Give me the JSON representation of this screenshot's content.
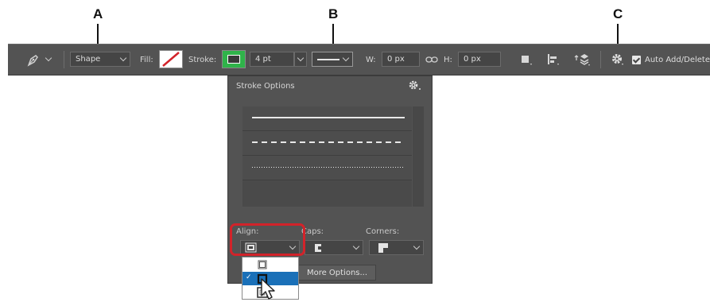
{
  "callouts": {
    "a": "A",
    "b": "B",
    "c": "C"
  },
  "toolbar": {
    "mode": "Shape",
    "fill_label": "Fill:",
    "stroke_label": "Stroke:",
    "stroke_width": "4 pt",
    "w_label": "W:",
    "w_value": "0 px",
    "h_label": "H:",
    "h_value": "0 px",
    "auto_add_label": "Auto Add/Delete",
    "auto_add_checked": true
  },
  "panel": {
    "title": "Stroke Options",
    "line_styles": [
      "solid",
      "dashed",
      "dotted"
    ],
    "align_label": "Align:",
    "caps_label": "Caps:",
    "corners_label": "Corners:",
    "more_options": "More Options..."
  },
  "align_dropdown": {
    "options": [
      "inside",
      "center",
      "outside"
    ],
    "selected": "center",
    "check": "✓"
  },
  "colors": {
    "toolbar": "#535353",
    "selection": "#1a70b8",
    "highlight": "#d2232a",
    "stroke_swatch": "#2fb34a"
  },
  "icons": [
    "pen-tool-icon",
    "link-icon",
    "gear-icon",
    "path-operations-icon",
    "path-alignment-icon",
    "path-arrangement-icon",
    "cursor-arrow-icon"
  ]
}
